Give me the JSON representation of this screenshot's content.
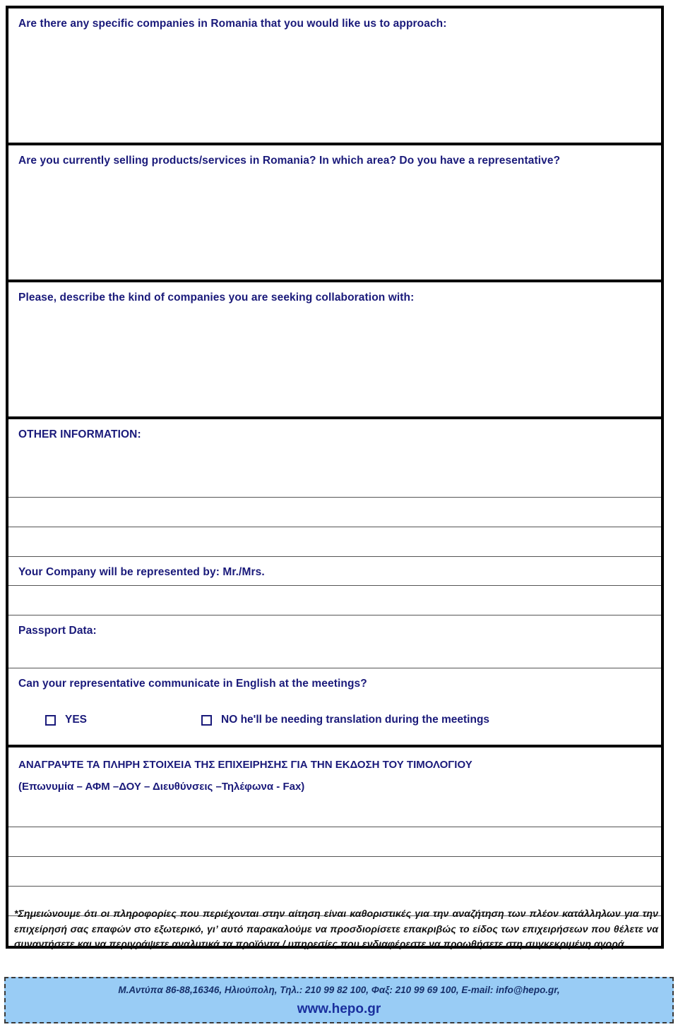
{
  "document": {
    "type": "business-cooperation-application-form",
    "language": "English and Greek"
  },
  "sections": {
    "specific_companies": {
      "question": "Are there any specific companies in Romania that you would like us to approach:"
    },
    "currently_selling": {
      "question": "Are you currently selling products/services in Romania? In which area? Do you have a representative?"
    },
    "company_kind": {
      "question": "Please, describe the kind of companies you are seeking collaboration with:"
    },
    "other_information": {
      "heading": "OTHER INFORMATION:"
    },
    "representative": {
      "label": "Your Company will be represented by: Mr./Mrs."
    },
    "passport": {
      "label": "Passport Data:"
    },
    "english_question": {
      "question": "Can your representative communicate in English at the meetings?",
      "options": [
        {
          "label": "YES",
          "checked": false
        },
        {
          "label": "NO he'll be needing translation during the meetings",
          "checked": false
        }
      ]
    },
    "invoice_details": {
      "line1": "ΑΝΑΓΡΑΨΤΕ ΤΑ ΠΛΗΡΗ ΣΤΟΙΧΕΙΑ ΤΗΣ ΕΠΙΧΕΙΡΗΣΗΣ  ΓΙΑ ΤΗΝ ΕΚΔΟΣΗ ΤΟΥ ΤΙΜΟΛΟΓΙΟΥ",
      "line2": "(Επωνυμία – ΑΦΜ –ΔΟΥ – Διευθύνσεις –Τηλέφωνα - Fax)"
    }
  },
  "footnote": {
    "text": "*Σημειώνουμε ότι οι πληροφορίες που περιέχονται στην αίτηση είναι καθοριστικές για την αναζήτηση των πλέον κατάλληλων για την επιχείρησή σας επαφών στο εξωτερικό, γι’ αυτό παρακαλούμε να προσδιορίσετε επακριβώς το είδος των επιχειρήσεων που θέλετε να συναντήσετε και να περιγράψετε αναλυτικά τα προϊόντα / υπηρεσίες που ενδιαφέρεστε να προωθήσετε στη συγκεκριμένη αγορά."
  },
  "footer": {
    "contact": "Μ.Αντύπα 86-88,16346, Ηλιούπολη, Τηλ.: 210 99 82 100, Φαξ: 210 99 69 100, E-mail: info@hepo.gr,",
    "url": "www.hepo.gr"
  },
  "colors": {
    "text_navy": "#1a1a7a",
    "footer_background": "#99ccf5",
    "footer_url": "#1a2f9e",
    "rule": "#000000"
  }
}
